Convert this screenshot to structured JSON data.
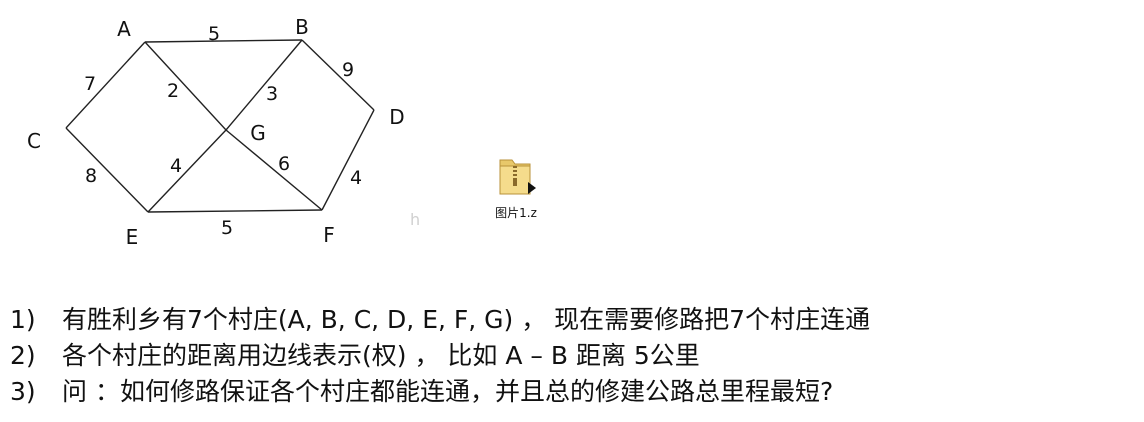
{
  "graph": {
    "vertices": [
      "A",
      "B",
      "C",
      "D",
      "E",
      "F",
      "G"
    ],
    "edges": [
      {
        "from": "A",
        "to": "B",
        "weight": "5"
      },
      {
        "from": "A",
        "to": "C",
        "weight": "7"
      },
      {
        "from": "A",
        "to": "G",
        "weight": "2"
      },
      {
        "from": "B",
        "to": "G",
        "weight": "3"
      },
      {
        "from": "B",
        "to": "D",
        "weight": "9"
      },
      {
        "from": "C",
        "to": "E",
        "weight": "8"
      },
      {
        "from": "E",
        "to": "G",
        "weight": "4"
      },
      {
        "from": "G",
        "to": "F",
        "weight": "6"
      },
      {
        "from": "D",
        "to": "F",
        "weight": "4"
      },
      {
        "from": "E",
        "to": "F",
        "weight": "5"
      }
    ]
  },
  "file_icon": {
    "label": "图片1.z",
    "icon": "folder-zip-icon"
  },
  "stray_char": "h",
  "problem": {
    "items": [
      {
        "num": "1)",
        "text": "有胜利乡有7个村庄(A, B, C, D, E, F, G) ， 现在需要修路把7个村庄连通"
      },
      {
        "num": "2)",
        "text": "各个村庄的距离用边线表示(权) ， 比如 A – B 距离 5公里"
      },
      {
        "num": "3)",
        "text": "问 ：如何修路保证各个村庄都能连通，并且总的修建公路总里程最短?"
      }
    ]
  }
}
